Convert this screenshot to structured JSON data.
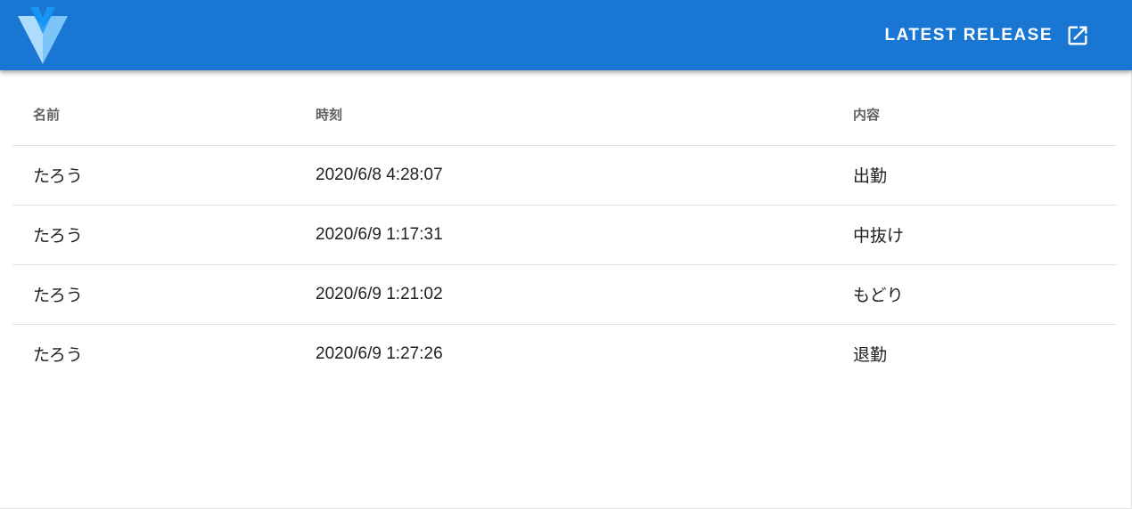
{
  "header": {
    "release_label": "LATEST RELEASE",
    "brand_color": "#1976d2",
    "logo_icon": "vuetify-logo-icon",
    "external_icon": "open-in-new-icon"
  },
  "table": {
    "columns": [
      "名前",
      "時刻",
      "内容"
    ],
    "rows": [
      [
        "たろう",
        "2020/6/8 4:28:07",
        "出勤"
      ],
      [
        "たろう",
        "2020/6/9 1:17:31",
        "中抜け"
      ],
      [
        "たろう",
        "2020/6/9 1:21:02",
        "もどり"
      ],
      [
        "たろう",
        "2020/6/9 1:27:26",
        "退勤"
      ]
    ]
  }
}
